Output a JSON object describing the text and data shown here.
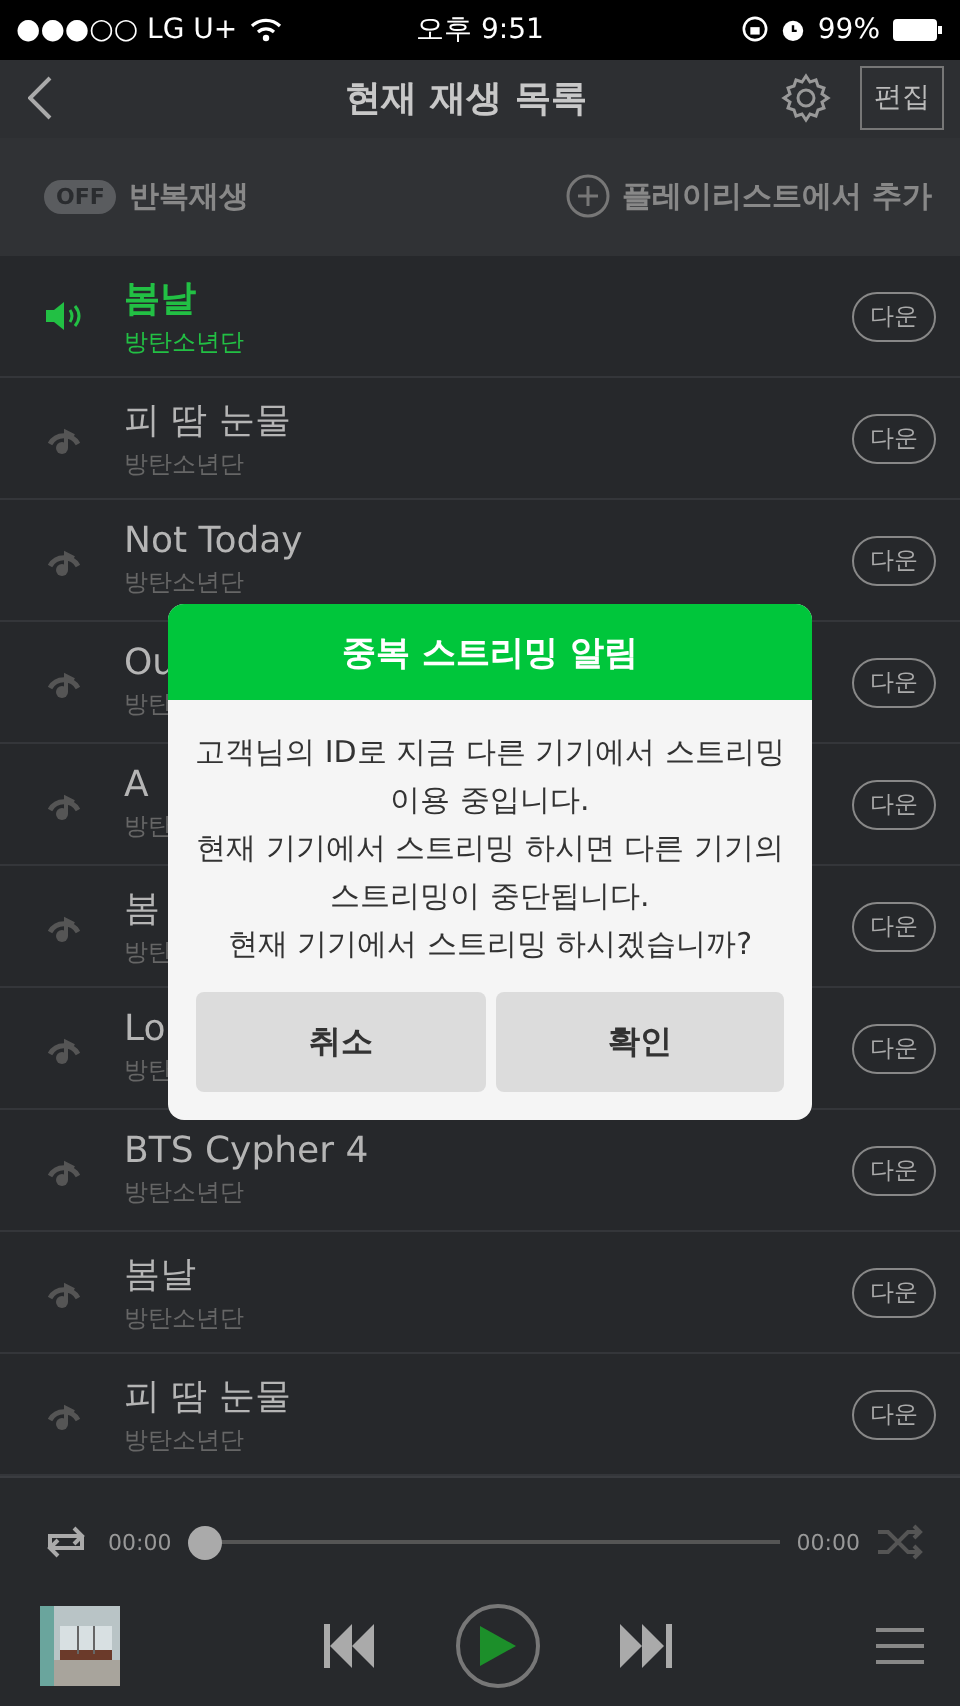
{
  "status_bar": {
    "carrier": "●●●○○ LG U+",
    "time": "오후 9:51",
    "battery": "99%"
  },
  "header": {
    "title": "현재 재생 목록",
    "edit_button": "편집"
  },
  "toolbar": {
    "repeat": {
      "switch_label": "OFF",
      "on": false,
      "label": "반복재생"
    },
    "add_from_playlist": "플레이리스트에서 추가"
  },
  "tracks": [
    {
      "title": "봄날",
      "artist": "방탄소년단",
      "playing": true,
      "download": "다운"
    },
    {
      "title": "피 땀 눈물",
      "artist": "방탄소년단",
      "playing": false,
      "download": "다운"
    },
    {
      "title": "Not Today",
      "artist": "방탄소년단",
      "playing": false,
      "download": "다운"
    },
    {
      "title": "Ou",
      "artist": "방탄",
      "playing": false,
      "download": "다운"
    },
    {
      "title": "A",
      "artist": "방탄",
      "playing": false,
      "download": "다운"
    },
    {
      "title": "봄",
      "artist": "방탄",
      "playing": false,
      "download": "다운"
    },
    {
      "title": "Lo",
      "artist": "방탄",
      "playing": false,
      "download": "다운"
    },
    {
      "title": "BTS Cypher 4",
      "artist": "방탄소년단",
      "playing": false,
      "download": "다운"
    },
    {
      "title": "봄날",
      "artist": "방탄소년단",
      "playing": false,
      "download": "다운"
    },
    {
      "title": "피 땀 눈물",
      "artist": "방탄소년단",
      "playing": false,
      "download": "다운"
    }
  ],
  "player": {
    "elapsed": "00:00",
    "total": "00:00",
    "level": 0
  },
  "dialog": {
    "title": "중복 스트리밍 알림",
    "message": "고객님의 ID로 지금 다른 기기에서 스트리밍 이용 중입니다.\n현재 기기에서 스트리밍 하시면 다른 기기의 스트리밍이 중단됩니다.\n현재 기기에서 스트리밍 하시겠습니까?",
    "buttons": [
      "취소",
      "확인"
    ]
  }
}
